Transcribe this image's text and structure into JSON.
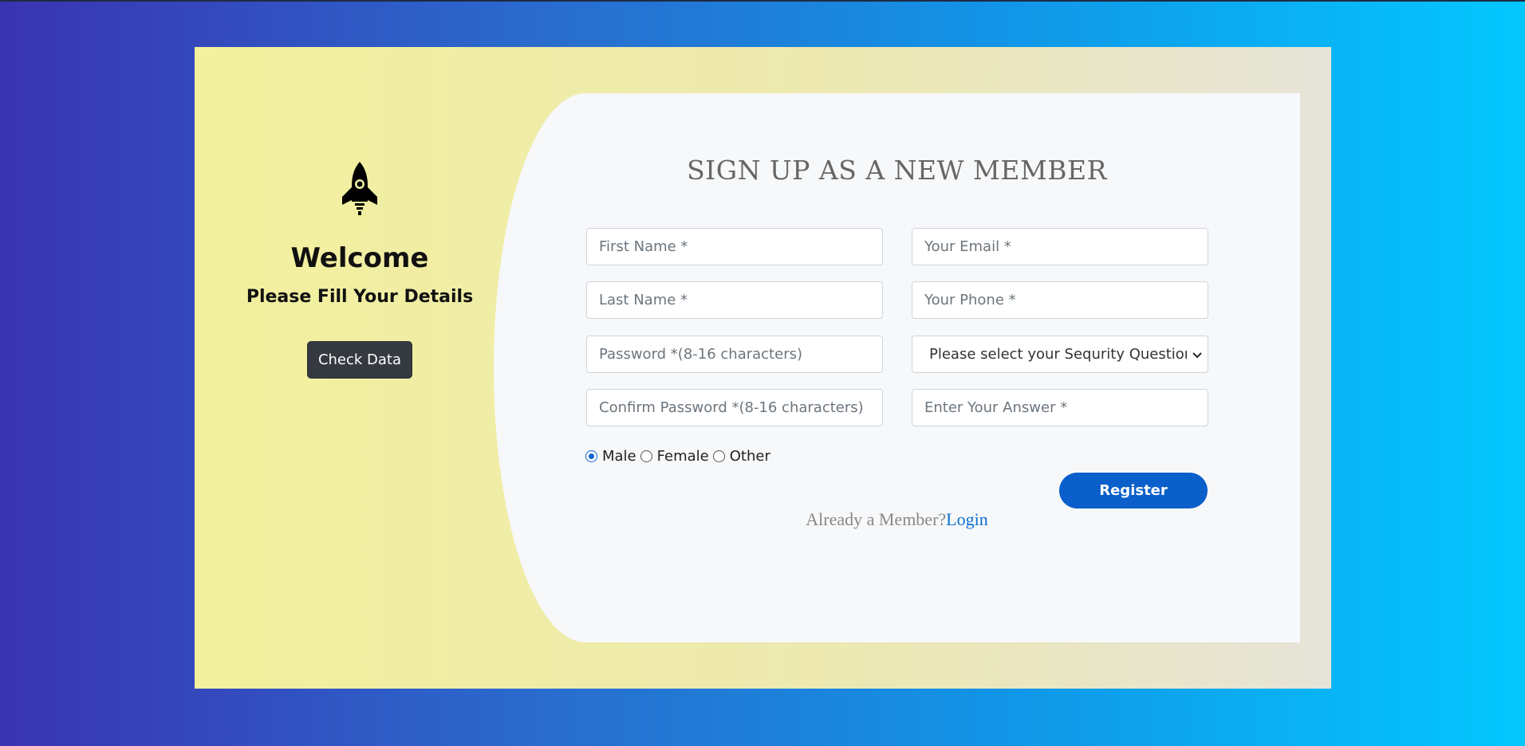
{
  "welcome_panel": {
    "icon": "rocket-icon",
    "title": "Welcome",
    "subtitle": "Please Fill Your Details",
    "check_button_label": "Check Data"
  },
  "form": {
    "title": "SIGN UP AS A NEW MEMBER",
    "first_name_placeholder": "First Name *",
    "last_name_placeholder": "Last Name *",
    "password_placeholder": "Password *(8-16 characters)",
    "confirm_password_placeholder": "Confirm Password *(8-16 characters)",
    "email_placeholder": "Your Email *",
    "phone_placeholder": "Your Phone *",
    "security_question_selected": "Please select your Sequrity Question",
    "answer_placeholder": "Enter Your Answer *",
    "gender_options": [
      {
        "label": "Male",
        "checked": true
      },
      {
        "label": "Female",
        "checked": false
      },
      {
        "label": "Other",
        "checked": false
      }
    ],
    "register_label": "Register",
    "member_prompt": "Already a Member?",
    "login_label": "Login"
  },
  "colors": {
    "accent": "#0a5fca",
    "link": "#0b6fd4",
    "dark_button": "#343a40"
  }
}
